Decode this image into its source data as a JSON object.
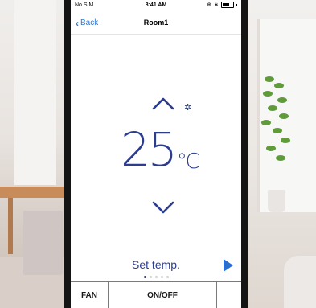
{
  "status_bar": {
    "carrier": "No SIM",
    "time": "8:41 AM"
  },
  "nav": {
    "back_label": "Back",
    "title": "Room1"
  },
  "control": {
    "temperature": "25",
    "unit": "℃",
    "mode_icon": "snowflake-icon",
    "label": "Set temp."
  },
  "pager": {
    "pages": 5,
    "active_index": 0
  },
  "bottom_bar": {
    "fan_label": "FAN",
    "onoff_label": "ON/OFF"
  },
  "colors": {
    "accent_blue": "#2d3d8e",
    "ios_blue": "#2b7bd8"
  }
}
